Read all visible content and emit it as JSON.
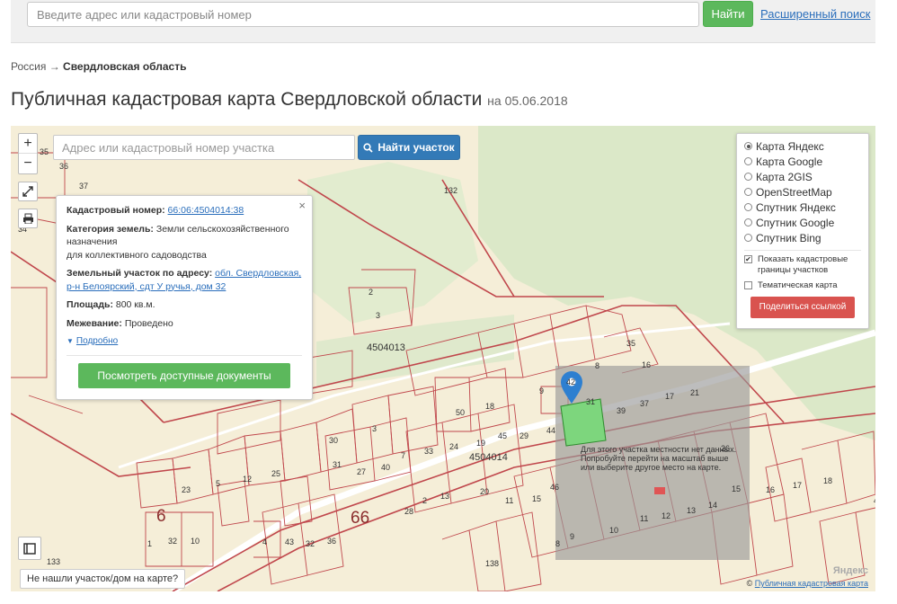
{
  "search": {
    "placeholder": "Введите адрес или кадастровый номер",
    "go_label": "Найти",
    "advanced_label": "Расширенный поиск"
  },
  "breadcrumb": {
    "root": "Россия",
    "separator": "→",
    "current": "Свердловская область"
  },
  "page": {
    "title": "Публичная кадастровая карта Свердловской области",
    "date": "на 05.06.2018"
  },
  "map": {
    "zoom_in": "+",
    "zoom_out": "−",
    "search_placeholder": "Адрес или кадастровый номер участка",
    "find_label": "Найти участок",
    "not_found_label": "Не нашли участок/дом на карте?",
    "copyright_prefix": "©",
    "copyright_link": "Публичная кадастровая карта",
    "provider_logo": "Яндекс",
    "no_data_message": "Для этого участка местности нет данных. Попробуйте перейти на масштаб выше или выберите другое место на карте.",
    "labels": {
      "quarter_main": "4504014",
      "quarter_upper": "4504013",
      "district": "66",
      "area": "6",
      "road": "132"
    }
  },
  "popup": {
    "close": "×",
    "cadastral_label": "Кадастровый номер:",
    "cadastral_value": "66:06:4504014:38",
    "category_label": "Категория земель:",
    "category_value": "Земли сельскохозяйственного назначения",
    "category_value_2": "для коллективного садоводства",
    "address_label": "Земельный участок по адресу:",
    "address_value": "обл. Свердловская, р-н Белоярский, сдт У ручья, дом 32",
    "area_label": "Площадь:",
    "area_value": "800 кв.м.",
    "survey_label": "Межевание:",
    "survey_value": "Проведено",
    "more_label": "Подробно",
    "docs_button": "Посмотреть доступные документы"
  },
  "layers": {
    "options": [
      {
        "label": "Карта Яндекс",
        "selected": true
      },
      {
        "label": "Карта Google",
        "selected": false
      },
      {
        "label": "Карта 2GIS",
        "selected": false
      },
      {
        "label": "OpenStreetMap",
        "selected": false
      },
      {
        "label": "Спутник Яндекс",
        "selected": false
      },
      {
        "label": "Спутник Google",
        "selected": false
      },
      {
        "label": "Спутник Bing",
        "selected": false
      }
    ],
    "show_borders_label": "Показать кадастровые границы участков",
    "show_borders_checked": true,
    "thematic_label": "Тематическая карта",
    "thematic_checked": false,
    "share_button": "Поделиться ссылкой"
  },
  "colors": {
    "map_background": "#f5eed8",
    "parcel_border": "#c0474c",
    "selected_parcel": "#7dd67d",
    "marker": "#2d7fd0",
    "find_button": "#337ab7",
    "green_button": "#5cb85c",
    "share_button": "#d9534f"
  }
}
